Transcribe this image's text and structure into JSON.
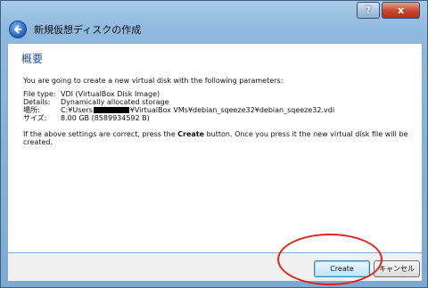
{
  "window": {
    "title_buttons": {
      "help": "?",
      "close": "x"
    }
  },
  "header": {
    "title": "新規仮想ディスクの作成"
  },
  "page": {
    "heading": "概要",
    "intro": "You are going to create a new virtual disk with the following parameters:",
    "params": [
      {
        "key": "File type:",
        "value": "VDI (VirtualBox Disk Image)"
      },
      {
        "key": "Details:",
        "value": "Dynamically allocated storage"
      },
      {
        "key": "場所:",
        "value_prefix": "C:¥Users",
        "value_suffix": "¥VirtualBox VMs¥debian_sqeeze32¥debian_sqeeze32.vdi"
      },
      {
        "key": "サイズ:",
        "value": "8.00 GB (8589934592 B)"
      }
    ],
    "note_before": "If the above settings are correct, press the ",
    "note_bold": "Create",
    "note_after": " button. Once you press it the new virtual disk file will be",
    "note_line2": "created."
  },
  "footer": {
    "create_label": "Create",
    "cancel_label": "キャンセル"
  },
  "colors": {
    "title_bar": "#8fb9df",
    "heading": "#1f4f8f",
    "annotation": "#e0241c"
  },
  "icons": [
    "help-icon",
    "close-icon",
    "back-arrow-icon"
  ]
}
